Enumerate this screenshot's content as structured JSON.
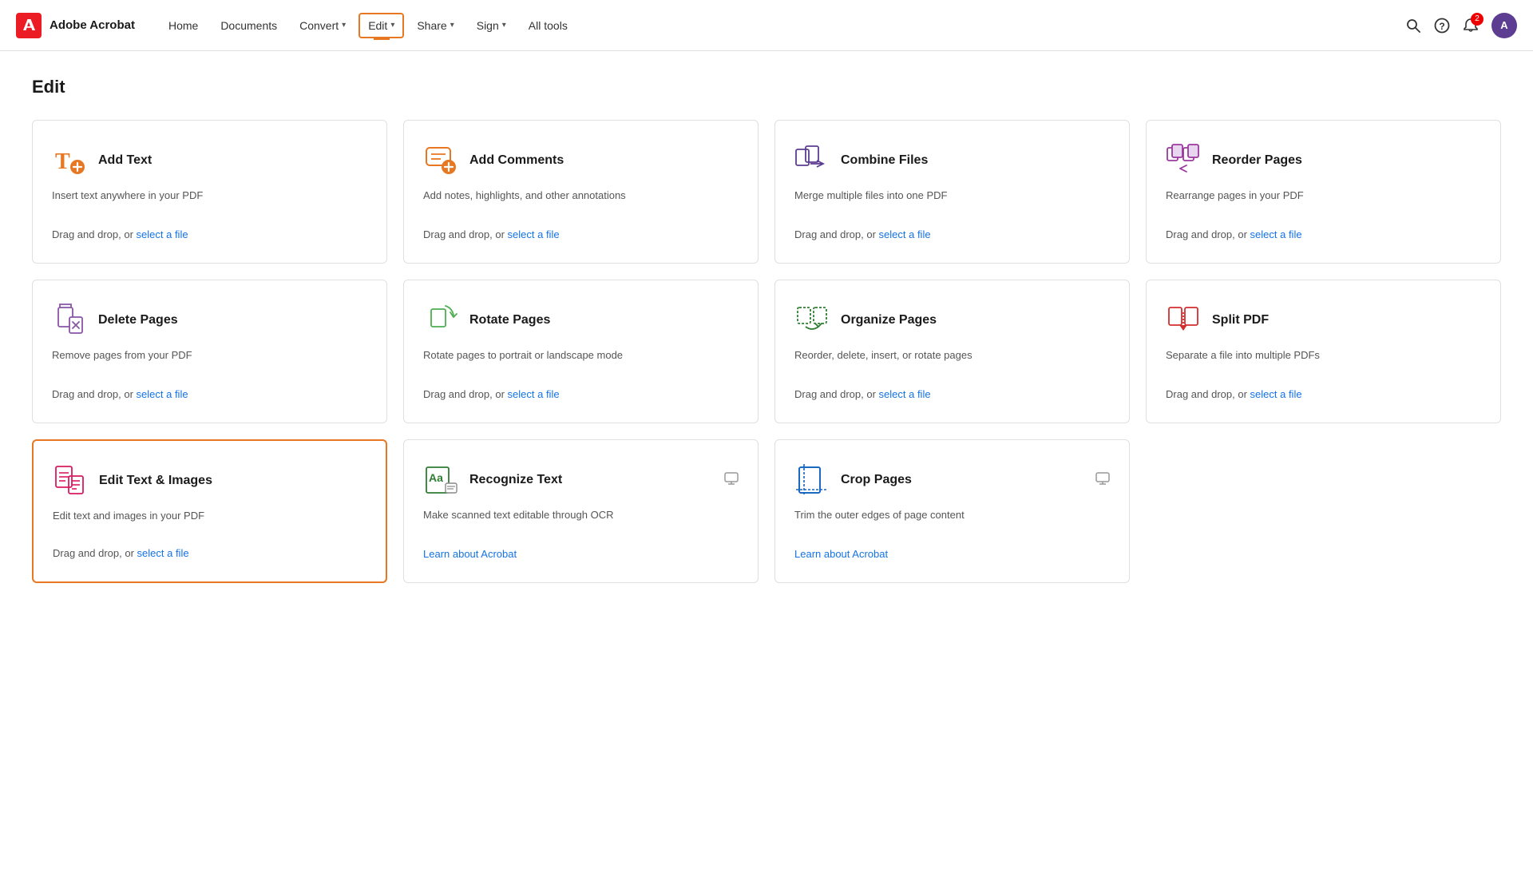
{
  "brand": "Adobe Acrobat",
  "nav": {
    "items": [
      {
        "label": "Home",
        "hasChevron": false,
        "active": false
      },
      {
        "label": "Documents",
        "hasChevron": false,
        "active": false
      },
      {
        "label": "Convert",
        "hasChevron": true,
        "active": false
      },
      {
        "label": "Edit",
        "hasChevron": true,
        "active": true
      },
      {
        "label": "Share",
        "hasChevron": true,
        "active": false
      },
      {
        "label": "Sign",
        "hasChevron": true,
        "active": false
      },
      {
        "label": "All tools",
        "hasChevron": false,
        "active": false
      }
    ],
    "notifCount": "2"
  },
  "page": {
    "title": "Edit"
  },
  "tools": [
    {
      "id": "add-text",
      "name": "Add Text",
      "desc": "Insert text anywhere in your PDF",
      "action": "Drag and drop, or",
      "actionLink": "select a file",
      "selected": false,
      "iconColor": "#e87722",
      "desktopOnly": false,
      "learnLink": false
    },
    {
      "id": "add-comments",
      "name": "Add Comments",
      "desc": "Add notes, highlights, and other annotations",
      "action": "Drag and drop, or",
      "actionLink": "select a file",
      "selected": false,
      "iconColor": "#e87722",
      "desktopOnly": false,
      "learnLink": false
    },
    {
      "id": "combine-files",
      "name": "Combine Files",
      "desc": "Merge multiple files into one PDF",
      "action": "Drag and drop, or",
      "actionLink": "select a file",
      "selected": false,
      "iconColor": "#5c3d91",
      "desktopOnly": false,
      "learnLink": false
    },
    {
      "id": "reorder-pages",
      "name": "Reorder Pages",
      "desc": "Rearrange pages in your PDF",
      "action": "Drag and drop, or",
      "actionLink": "select a file",
      "selected": false,
      "iconColor": "#9b37a0",
      "desktopOnly": false,
      "learnLink": false
    },
    {
      "id": "delete-pages",
      "name": "Delete Pages",
      "desc": "Remove pages from your PDF",
      "action": "Drag and drop, or",
      "actionLink": "select a file",
      "selected": false,
      "iconColor": "#8856a7",
      "desktopOnly": false,
      "learnLink": false
    },
    {
      "id": "rotate-pages",
      "name": "Rotate Pages",
      "desc": "Rotate pages to portrait or landscape mode",
      "action": "Drag and drop, or",
      "actionLink": "select a file",
      "selected": false,
      "iconColor": "#4caf50",
      "desktopOnly": false,
      "learnLink": false
    },
    {
      "id": "organize-pages",
      "name": "Organize Pages",
      "desc": "Reorder, delete, insert, or rotate pages",
      "action": "Drag and drop, or",
      "actionLink": "select a file",
      "selected": false,
      "iconColor": "#2e7d32",
      "desktopOnly": false,
      "learnLink": false
    },
    {
      "id": "split-pdf",
      "name": "Split PDF",
      "desc": "Separate a file into multiple PDFs",
      "action": "Drag and drop, or",
      "actionLink": "select a file",
      "selected": false,
      "iconColor": "#d32f2f",
      "desktopOnly": false,
      "learnLink": false
    },
    {
      "id": "edit-text-images",
      "name": "Edit Text & Images",
      "desc": "Edit text and images in your PDF",
      "action": "Drag and drop, or",
      "actionLink": "select a file",
      "selected": true,
      "iconColor": "#d81b60",
      "desktopOnly": false,
      "learnLink": false
    },
    {
      "id": "recognize-text",
      "name": "Recognize Text",
      "desc": "Make scanned text editable through OCR",
      "action": null,
      "actionLink": null,
      "selected": false,
      "iconColor": "#2e7d32",
      "desktopOnly": true,
      "learnLink": "Learn about Acrobat"
    },
    {
      "id": "crop-pages",
      "name": "Crop Pages",
      "desc": "Trim the outer edges of page content",
      "action": null,
      "actionLink": null,
      "selected": false,
      "iconColor": "#1565c0",
      "desktopOnly": true,
      "learnLink": "Learn about Acrobat"
    }
  ]
}
